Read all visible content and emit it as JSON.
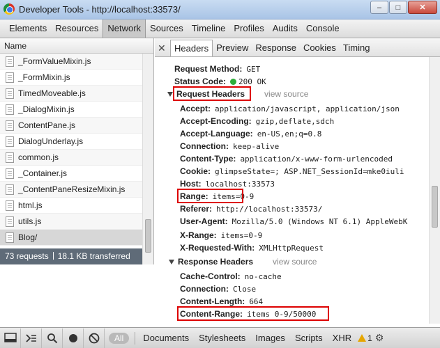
{
  "window": {
    "title": "Developer Tools - http://localhost:33573/",
    "minimize": "–",
    "maximize": "□",
    "close": "✕"
  },
  "panels": [
    "Elements",
    "Resources",
    "Network",
    "Sources",
    "Timeline",
    "Profiles",
    "Audits",
    "Console"
  ],
  "network": {
    "column_header": "Name",
    "files": [
      "_FormValueMixin.js",
      "_FormMixin.js",
      "TimedMoveable.js",
      "_DialogMixin.js",
      "ContentPane.js",
      "DialogUnderlay.js",
      "common.js",
      "_Container.js",
      "_ContentPaneResizeMixin.js",
      "html.js",
      "utils.js",
      "Blog/"
    ],
    "selected_file": "Blog/",
    "summary_requests": "73 requests",
    "summary_transferred": "18.1 KB transferred"
  },
  "detail_tabs": {
    "close": "✕",
    "tabs": [
      "Headers",
      "Preview",
      "Response",
      "Cookies",
      "Timing"
    ],
    "active": "Headers"
  },
  "headers": {
    "request_method_key": "Request Method:",
    "request_method_val": "GET",
    "status_code_key": "Status Code:",
    "status_code_val": "200 OK",
    "request_section": "Request Headers",
    "response_section": "Response Headers",
    "view_source": "view source",
    "request": [
      {
        "key": "Accept:",
        "value": "application/javascript, application/json"
      },
      {
        "key": "Accept-Encoding:",
        "value": "gzip,deflate,sdch"
      },
      {
        "key": "Accept-Language:",
        "value": "en-US,en;q=0.8"
      },
      {
        "key": "Connection:",
        "value": "keep-alive"
      },
      {
        "key": "Content-Type:",
        "value": "application/x-www-form-urlencoded"
      },
      {
        "key": "Cookie:",
        "value": "glimpseState=; ASP.NET_SessionId=mke0iuli"
      },
      {
        "key": "Host:",
        "value": "localhost:33573"
      },
      {
        "key": "Range:",
        "value": "items=0-9"
      },
      {
        "key": "Referer:",
        "value": "http://localhost:33573/"
      },
      {
        "key": "User-Agent:",
        "value": "Mozilla/5.0 (Windows NT 6.1) AppleWebK"
      },
      {
        "key": "X-Range:",
        "value": "items=0-9"
      },
      {
        "key": "X-Requested-With:",
        "value": "XMLHttpRequest"
      }
    ],
    "response": [
      {
        "key": "Cache-Control:",
        "value": "no-cache"
      },
      {
        "key": "Connection:",
        "value": "Close"
      },
      {
        "key": "Content-Length:",
        "value": "664"
      },
      {
        "key": "Content-Range:",
        "value": "items 0-9/50000"
      }
    ],
    "highlight_color": "#dd0000"
  },
  "bottom": {
    "filters": [
      "All",
      "Documents",
      "Stylesheets",
      "Images",
      "Scripts",
      "XHR"
    ],
    "warning_count": "1",
    "icons": [
      "dock-icon",
      "console-icon",
      "search-icon",
      "record-icon",
      "clear-icon",
      "settings-icon"
    ]
  }
}
